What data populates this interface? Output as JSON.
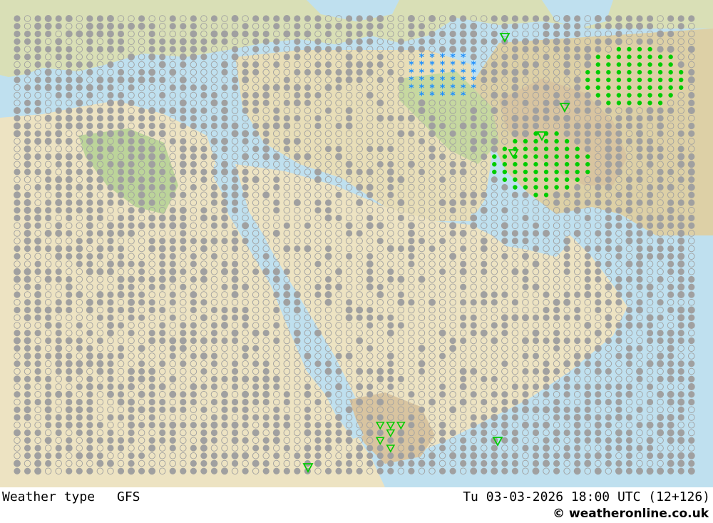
{
  "footer": {
    "title": "Weather type",
    "model": "GFS",
    "valid": "Tu 03-03-2026 18:00 UTC (12+126)",
    "credit_symbol": "©",
    "credit": "weatheronline.co.uk"
  },
  "colors": {
    "sea": "#bfe0ef",
    "land_desert": "#ede3c2",
    "land_green": "#bcd49a",
    "land_hills": "#d8c4a0",
    "rain": "#00cc00",
    "snow": "#1e90ff",
    "cloud": "#a0a0a0"
  },
  "symbols": {
    "overcast": "filled-circle",
    "partly_cloudy": "half-circle",
    "clear": "open-circle",
    "rain": "green-dot",
    "showers": "green-triangle",
    "snow": "blue-asterisk"
  }
}
